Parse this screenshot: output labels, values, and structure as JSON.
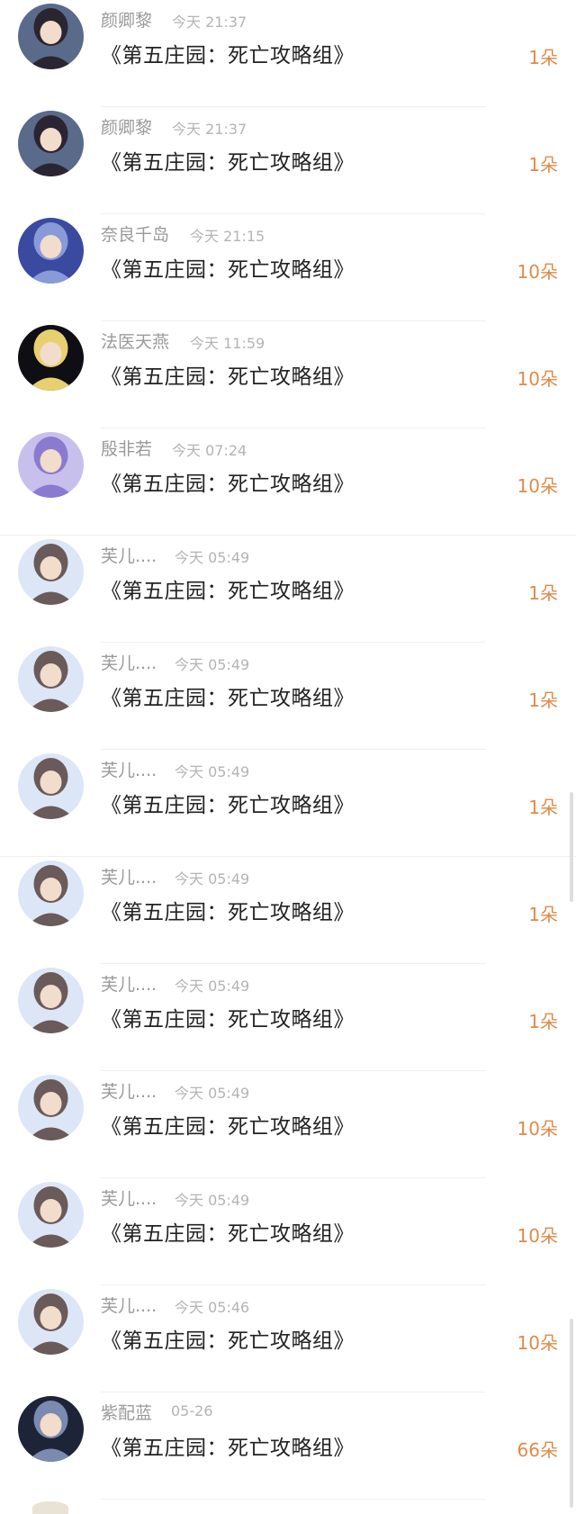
{
  "gifts": [
    {
      "name": "颜卿黎",
      "time": "今天 21:37",
      "book": "《第五庄园：死亡攻略组》",
      "count": "1朵",
      "avatar_icon": "dark-hair-girl-avatar-icon",
      "avatar_bg": "#5a6a8a",
      "avatar_fg": "#2a2530"
    },
    {
      "name": "颜卿黎",
      "time": "今天 21:37",
      "book": "《第五庄园：死亡攻略组》",
      "count": "1朵",
      "avatar_icon": "dark-hair-girl-avatar-icon",
      "avatar_bg": "#5a6a8a",
      "avatar_fg": "#2a2530"
    },
    {
      "name": "奈良千岛",
      "time": "今天 21:15",
      "book": "《第五庄园：死亡攻略组》",
      "count": "10朵",
      "avatar_icon": "blue-silhouette-avatar-icon",
      "avatar_bg": "#3a4aa0",
      "avatar_fg": "#8a9ad8"
    },
    {
      "name": "法医天燕",
      "time": "今天 11:59",
      "book": "《第五庄园：死亡攻略组》",
      "count": "10朵",
      "avatar_icon": "blonde-dark-avatar-icon",
      "avatar_bg": "#0e0e14",
      "avatar_fg": "#e8d070"
    },
    {
      "name": "殷非若",
      "time": "今天 07:24",
      "book": "《第五庄园：死亡攻略组》",
      "count": "10朵",
      "avatar_icon": "lavender-girl-avatar-icon",
      "avatar_bg": "#c8c0ec",
      "avatar_fg": "#8a7ad0"
    },
    {
      "name": "芙儿....",
      "time": "今天 05:49",
      "book": "《第五庄园：死亡攻略组》",
      "count": "1朵",
      "avatar_icon": "cat-ear-girl-avatar-icon",
      "avatar_bg": "#dde6f6",
      "avatar_fg": "#6a5a5a"
    },
    {
      "name": "芙儿....",
      "time": "今天 05:49",
      "book": "《第五庄园：死亡攻略组》",
      "count": "1朵",
      "avatar_icon": "cat-ear-girl-avatar-icon",
      "avatar_bg": "#dde6f6",
      "avatar_fg": "#6a5a5a"
    },
    {
      "name": "芙儿....",
      "time": "今天 05:49",
      "book": "《第五庄园：死亡攻略组》",
      "count": "1朵",
      "avatar_icon": "cat-ear-girl-avatar-icon",
      "avatar_bg": "#dde6f6",
      "avatar_fg": "#6a5a5a"
    },
    {
      "name": "芙儿....",
      "time": "今天 05:49",
      "book": "《第五庄园：死亡攻略组》",
      "count": "1朵",
      "avatar_icon": "cat-ear-girl-avatar-icon",
      "avatar_bg": "#dde6f6",
      "avatar_fg": "#6a5a5a"
    },
    {
      "name": "芙儿....",
      "time": "今天 05:49",
      "book": "《第五庄园：死亡攻略组》",
      "count": "1朵",
      "avatar_icon": "cat-ear-girl-avatar-icon",
      "avatar_bg": "#dde6f6",
      "avatar_fg": "#6a5a5a"
    },
    {
      "name": "芙儿....",
      "time": "今天 05:49",
      "book": "《第五庄园：死亡攻略组》",
      "count": "10朵",
      "avatar_icon": "cat-ear-girl-avatar-icon",
      "avatar_bg": "#dde6f6",
      "avatar_fg": "#6a5a5a"
    },
    {
      "name": "芙儿....",
      "time": "今天 05:49",
      "book": "《第五庄园：死亡攻略组》",
      "count": "10朵",
      "avatar_icon": "cat-ear-girl-avatar-icon",
      "avatar_bg": "#dde6f6",
      "avatar_fg": "#6a5a5a"
    },
    {
      "name": "芙儿....",
      "time": "今天 05:46",
      "book": "《第五庄园：死亡攻略组》",
      "count": "10朵",
      "avatar_icon": "cat-ear-girl-avatar-icon",
      "avatar_bg": "#dde6f6",
      "avatar_fg": "#6a5a5a"
    },
    {
      "name": "紫配蓝",
      "time": "05-26",
      "book": "《第五庄园：死亡攻略组》",
      "count": "66朵",
      "avatar_icon": "dark-blue-girl-avatar-icon",
      "avatar_bg": "#1e2438",
      "avatar_fg": "#7a8ab0"
    }
  ],
  "colors": {
    "count_accent": "#e08a4a",
    "name_gray": "#9a9a9a",
    "time_gray": "#b4b4b4",
    "title_text": "#222222"
  }
}
